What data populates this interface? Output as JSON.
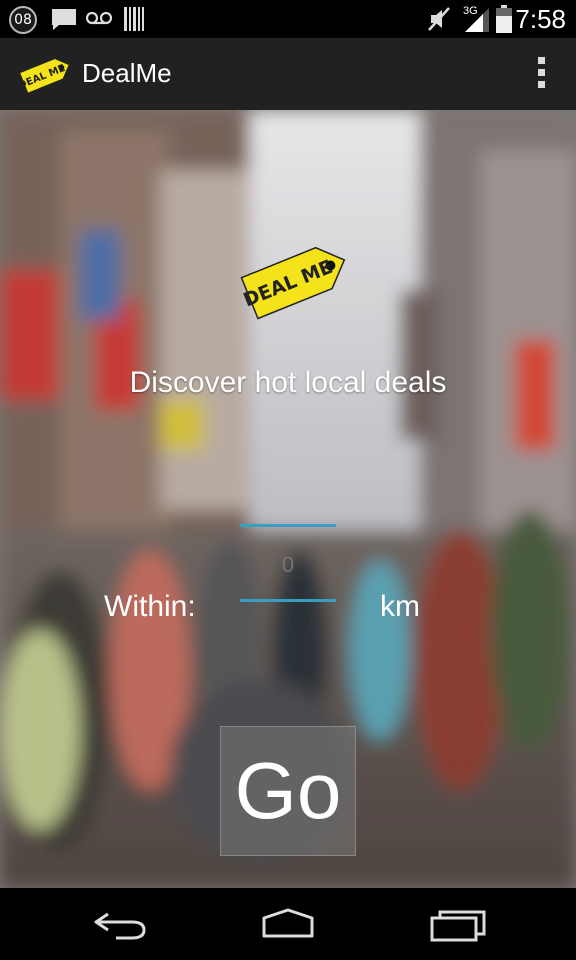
{
  "status_bar": {
    "notification_count": "08",
    "network": "3G",
    "time": "7:58",
    "icons": [
      "notification-count-icon",
      "message-icon",
      "voicemail-icon",
      "barcode-icon",
      "mute-icon",
      "signal-icon",
      "battery-icon"
    ]
  },
  "action_bar": {
    "title": "DealMe",
    "logo_text": "DEAL ME",
    "menu_icon": "overflow-menu-icon"
  },
  "main": {
    "hero_logo_text": "DEAL ME",
    "tagline": "Discover hot local deals",
    "within_label": "Within:",
    "distance_value": "",
    "distance_placeholder": "0",
    "unit_label": "km",
    "go_label": "Go"
  },
  "nav_bar": {
    "icons": [
      "back-icon",
      "home-icon",
      "recent-apps-icon"
    ]
  },
  "colors": {
    "action_bar_bg": "#212121",
    "field_underline": "#3b9dc4",
    "logo_yellow": "#f4e31a"
  }
}
